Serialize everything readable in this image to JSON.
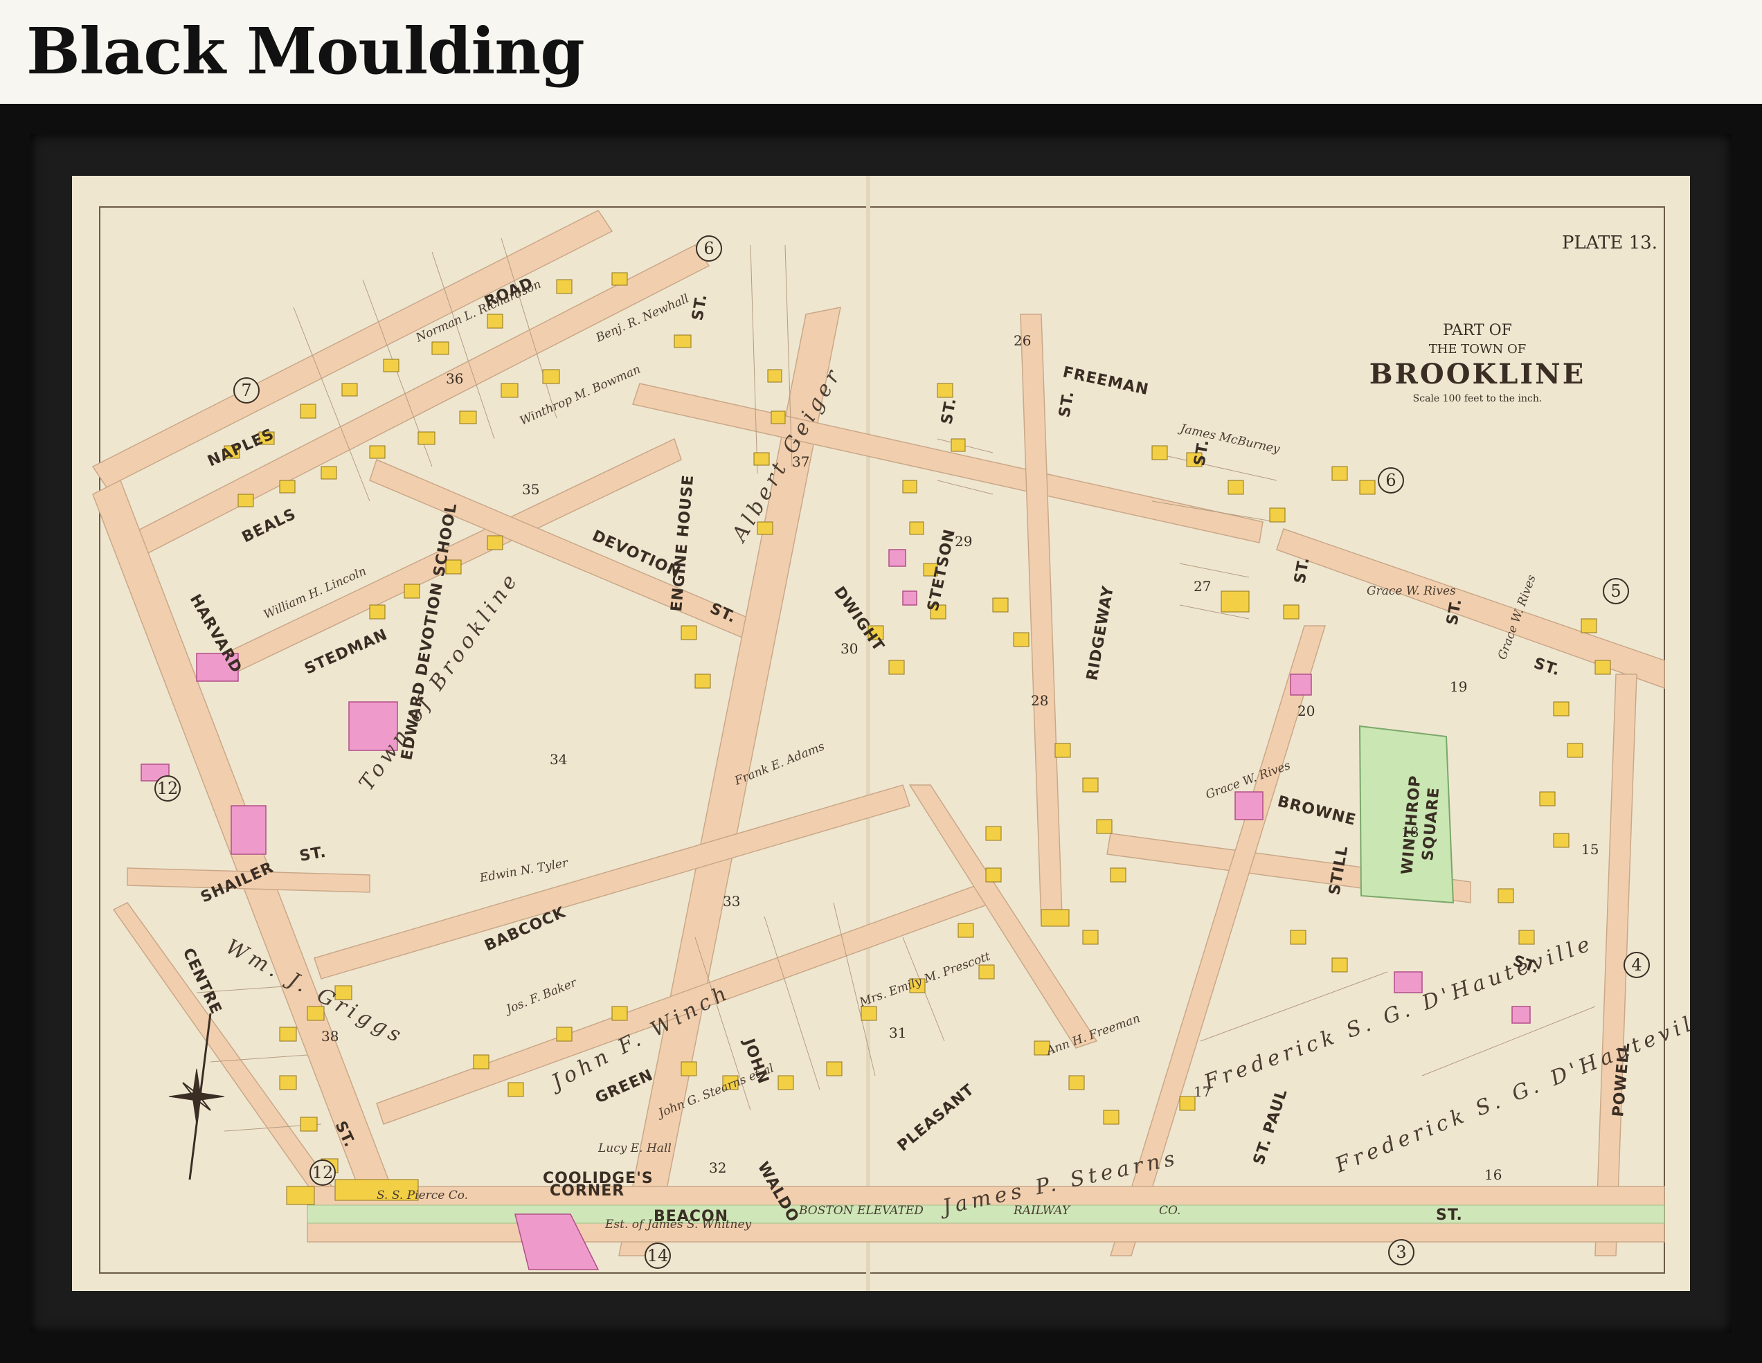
{
  "header": {
    "title": "Black Moulding"
  },
  "map": {
    "plate": "PLATE 13.",
    "cartouche": {
      "line1": "PART OF",
      "line2": "THE TOWN OF",
      "line3": "BROOKLINE",
      "scale": "Scale 100 feet to the inch."
    },
    "streets": {
      "road": "ROAD",
      "naples": "NAPLES",
      "beals": "BEALS",
      "harvard": "HARVARD",
      "stedman": "STEDMAN",
      "devotion": "DEVOTION",
      "devotion_st": "ST.",
      "dwight": "DWIGHT",
      "stetson": "STETSON",
      "freeman": "FREEMAN",
      "ridgeway": "RIDGEWAY",
      "browne": "BROWNE",
      "still": "STILL",
      "babcock": "BABCOCK",
      "shailer": "SHAILER",
      "shailer_st": "ST.",
      "centre": "CENTRE",
      "green": "GREEN",
      "john": "JOHN",
      "waldo": "WALDO",
      "pleasant": "PLEASANT",
      "st_paul": "ST. PAUL",
      "powell": "POWELL",
      "beacon": "BEACON",
      "beacon_st": "ST.",
      "railway": "BOSTON ELEVATED",
      "railway2": "RAILWAY",
      "railway3": "CO.",
      "coolidges": "COOLIDGE'S",
      "corner": "CORNER",
      "st1": "ST.",
      "st2": "ST.",
      "st3": "ST.",
      "st4": "ST.",
      "st5": "ST.",
      "st6": "ST.",
      "st7": "ST.",
      "st8": "ST.",
      "st9": "ST."
    },
    "circles": [
      "6",
      "7",
      "12",
      "12",
      "6",
      "5",
      "4",
      "14",
      "3"
    ],
    "blocks": [
      "36",
      "35",
      "37",
      "26",
      "29",
      "28",
      "27",
      "30",
      "34",
      "33",
      "31",
      "32",
      "38",
      "20",
      "19",
      "18",
      "17",
      "16",
      "15"
    ],
    "square": {
      "line1": "WINTHROP",
      "line2": "SQUARE"
    },
    "buildings": {
      "school": "EDWARD DEVOTION SCHOOL",
      "engine": "ENGINE HOUSE"
    },
    "owners": {
      "town": "Town of Brookline",
      "griggs": "Wm. J. Griggs",
      "stearns": "James P. Stearns",
      "hauteville": "Frederick S. G. D'Hauteville",
      "hauteville2": "Frederick S. G. D'Hauteville",
      "winch": "John F. Winch",
      "tyler": "Edwin N. Tyler",
      "geiger": "Albert Geiger",
      "whitney": "Est. of James S. Whitney",
      "prescott": "Mrs. Emily M. Prescott",
      "rives": "Grace W. Rives",
      "rives2": "Grace W. Rives",
      "rives3": "Grace W. Rives",
      "newhall": "Benj. R. Newhall",
      "bowman": "Winthrop M. Bowman",
      "richardson": "Norman L. Richardson",
      "williams": "William H. Lincoln",
      "pierce": "S. S. Pierce Co.",
      "freeman": "Ann H. Freeman",
      "adams": "Frank E. Adams",
      "baker": "Jos. F. Baker",
      "hall": "Lucy E. Hall",
      "stearns2": "John G. Stearns et al",
      "burney": "James McBurney"
    }
  }
}
